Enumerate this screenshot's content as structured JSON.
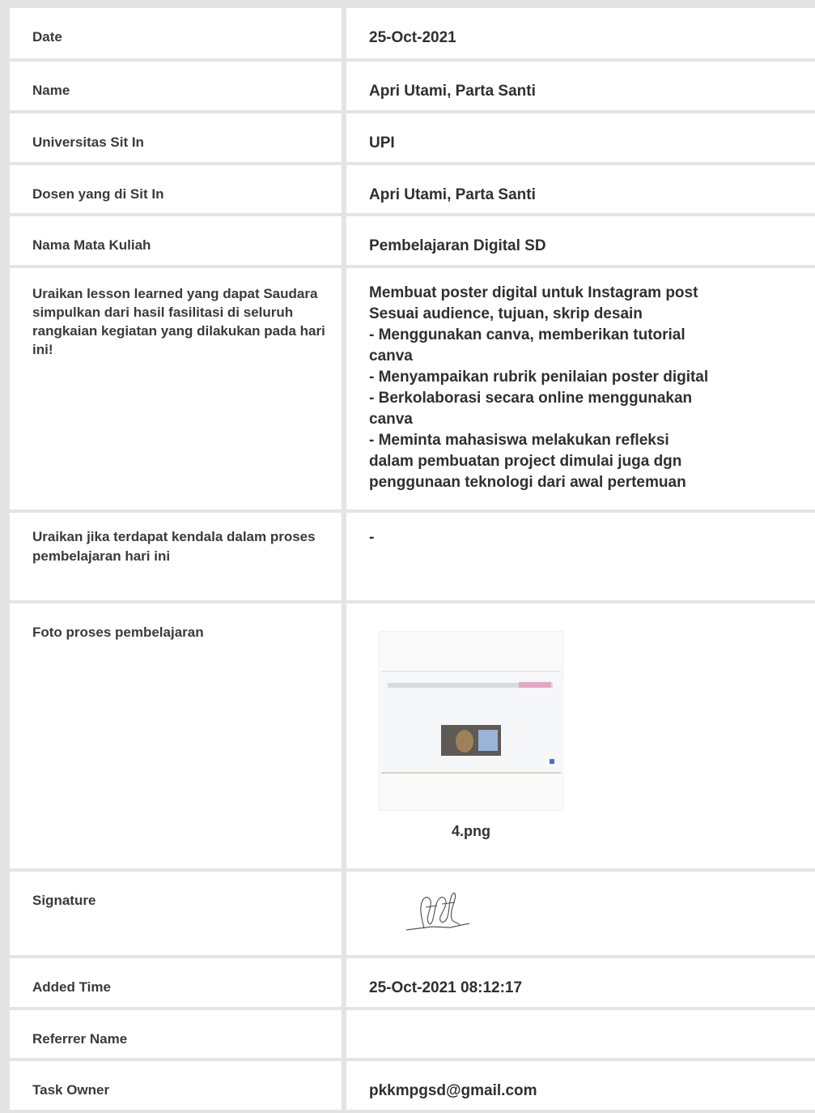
{
  "rows": {
    "date": {
      "label": "Date",
      "value": "25-Oct-2021"
    },
    "name": {
      "label": "Name",
      "value": "Apri Utami, Parta Santi"
    },
    "univ": {
      "label": "Universitas Sit In",
      "value": "UPI"
    },
    "dosen": {
      "label": "Dosen yang di Sit In",
      "value": "Apri Utami, Parta Santi"
    },
    "mk": {
      "label": "Nama Mata Kuliah",
      "value": "Pembelajaran Digital SD"
    },
    "lesson": {
      "label": "Uraikan lesson learned yang dapat Saudara simpulkan dari hasil fasilitasi di seluruh rangkaian kegiatan yang dilakukan pada hari ini!",
      "lines": [
        "Membuat poster digital untuk Instagram post",
        "Sesuai audience, tujuan, skrip desain",
        "- Menggunakan canva, memberikan tutorial",
        "canva",
        "- Menyampaikan rubrik penilaian poster digital",
        "- Berkolaborasi secara online menggunakan",
        "canva",
        "- Meminta mahasiswa melakukan refleksi",
        "dalam pembuatan project dimulai juga dgn",
        "penggunaan teknologi dari awal pertemuan"
      ]
    },
    "kendala": {
      "label": "Uraikan jika terdapat kendala dalam proses pembelajaran hari ini",
      "value": "-"
    },
    "foto": {
      "label": "Foto proses pembelajaran",
      "filename": "4.png"
    },
    "sign": {
      "label": "Signature"
    },
    "added": {
      "label": "Added Time",
      "value": "25-Oct-2021 08:12:17"
    },
    "ref": {
      "label": "Referrer Name",
      "value": ""
    },
    "owner": {
      "label": "Task Owner",
      "value": "pkkmpgsd@gmail.com"
    }
  }
}
